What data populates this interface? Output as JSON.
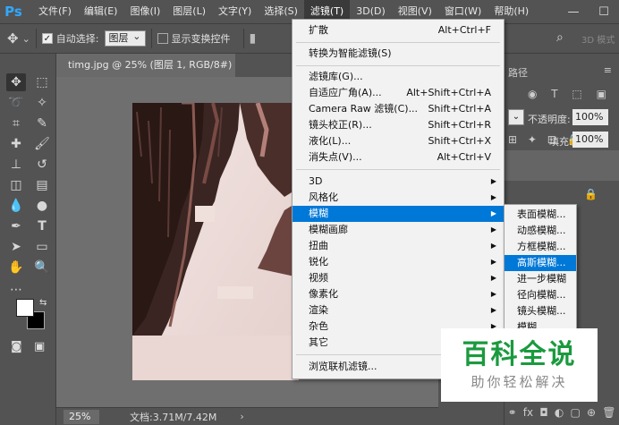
{
  "app": {
    "logo": "Ps"
  },
  "menubar": {
    "items": [
      "文件(F)",
      "编辑(E)",
      "图像(I)",
      "图层(L)",
      "文字(Y)",
      "选择(S)",
      "滤镜(T)",
      "3D(D)",
      "视图(V)",
      "窗口(W)",
      "帮助(H)"
    ],
    "window_controls": [
      "—",
      "☐"
    ]
  },
  "options": {
    "auto_select_label": "自动选择:",
    "auto_select_value": "图层",
    "show_transform_label": "显示变换控件",
    "mode_3d_label": "3D 模式"
  },
  "document": {
    "tab_title": "timg.jpg @ 25% (图层 1, RGB/8#) *",
    "tab_close": "×",
    "zoom": "25%",
    "doc_info": "文档:3.71M/7.42M"
  },
  "filter_menu": {
    "items": [
      {
        "label": "扩散",
        "shortcut": "Alt+Ctrl+F"
      },
      {
        "label": "转换为智能滤镜(S)"
      },
      {
        "label": "滤镜库(G)..."
      },
      {
        "label": "自适应广角(A)...",
        "shortcut": "Alt+Shift+Ctrl+A"
      },
      {
        "label": "Camera Raw 滤镜(C)...",
        "shortcut": "Shift+Ctrl+A"
      },
      {
        "label": "镜头校正(R)...",
        "shortcut": "Shift+Ctrl+R"
      },
      {
        "label": "液化(L)...",
        "shortcut": "Shift+Ctrl+X"
      },
      {
        "label": "消失点(V)...",
        "shortcut": "Alt+Ctrl+V"
      },
      {
        "label": "3D"
      },
      {
        "label": "风格化"
      },
      {
        "label": "模糊"
      },
      {
        "label": "模糊画廊"
      },
      {
        "label": "扭曲"
      },
      {
        "label": "锐化"
      },
      {
        "label": "视频"
      },
      {
        "label": "像素化"
      },
      {
        "label": "渲染"
      },
      {
        "label": "杂色"
      },
      {
        "label": "其它"
      },
      {
        "label": "浏览联机滤镜..."
      }
    ]
  },
  "blur_submenu": {
    "items": [
      "表面模糊...",
      "动感模糊...",
      "方框模糊...",
      "高斯模糊...",
      "进一步模糊",
      "径向模糊...",
      "镜头模糊...",
      "模糊"
    ]
  },
  "right_panel": {
    "tab_label": "路径",
    "opacity_label": "不透明度:",
    "opacity_value": "100%",
    "fill_label": "填充:",
    "fill_value": "100%"
  },
  "watermark": {
    "title": "百科全说",
    "subtitle": "助你轻松解决"
  },
  "colors": {
    "accent": "#0078d7",
    "ps_blue": "#31a8ff",
    "watermark_green": "#1a9a3e"
  }
}
